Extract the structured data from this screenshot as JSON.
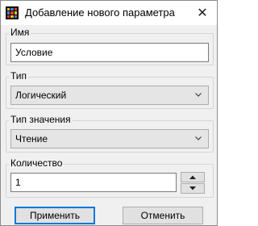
{
  "window": {
    "title": "Добавление нового параметра",
    "close_symbol": "✕",
    "icon": "grid-app-icon"
  },
  "name_group": {
    "label": "Имя",
    "value": "Условие"
  },
  "type_group": {
    "label": "Тип",
    "selected": "Логический"
  },
  "value_type_group": {
    "label": "Тип значения",
    "selected": "Чтение"
  },
  "count_group": {
    "label": "Количество",
    "value": "1"
  },
  "buttons": {
    "apply": "Применить",
    "cancel": "Отменить"
  },
  "colors": {
    "accent": "#0078d7",
    "window_bg": "#f0f0f0"
  }
}
